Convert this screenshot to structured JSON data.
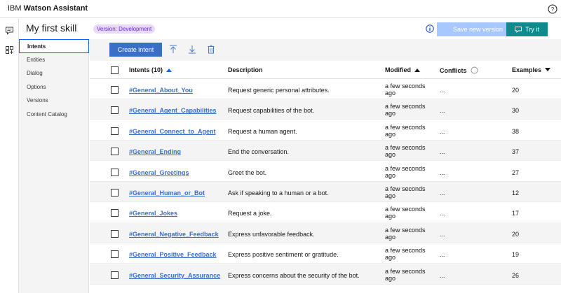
{
  "header": {
    "brand_prefix": "IBM",
    "brand_name": "Watson Assistant"
  },
  "skill": {
    "title": "My first skill",
    "version_badge": "Version: Development",
    "save_label": "Save new version",
    "try_label": "Try it"
  },
  "subnav": {
    "items": [
      {
        "label": "Intents",
        "active": true
      },
      {
        "label": "Entities"
      },
      {
        "label": "Dialog"
      },
      {
        "label": "Options"
      },
      {
        "label": "Versions"
      },
      {
        "label": "Content Catalog"
      }
    ]
  },
  "toolbar": {
    "create_label": "Create intent"
  },
  "table": {
    "columns": {
      "intents": "Intents (10)",
      "description": "Description",
      "modified": "Modified",
      "conflicts": "Conflicts",
      "examples": "Examples"
    },
    "rows": [
      {
        "intent": "#General_About_You",
        "description": "Request generic personal attributes.",
        "modified_1": "a few seconds",
        "modified_2": "ago",
        "conflicts": "...",
        "examples": "20"
      },
      {
        "intent": "#General_Agent_Capabilities",
        "description": "Request capabilities of the bot.",
        "modified_1": "a few seconds",
        "modified_2": "ago",
        "conflicts": "...",
        "examples": "30"
      },
      {
        "intent": "#General_Connect_to_Agent",
        "description": "Request a human agent.",
        "modified_1": "a few seconds",
        "modified_2": "ago",
        "conflicts": "...",
        "examples": "38"
      },
      {
        "intent": "#General_Ending",
        "description": "End the conversation.",
        "modified_1": "a few seconds",
        "modified_2": "ago",
        "conflicts": "...",
        "examples": "37"
      },
      {
        "intent": "#General_Greetings",
        "description": "Greet the bot.",
        "modified_1": "a few seconds",
        "modified_2": "ago",
        "conflicts": "...",
        "examples": "27"
      },
      {
        "intent": "#General_Human_or_Bot",
        "description": "Ask if speaking to a human or a bot.",
        "modified_1": "a few seconds",
        "modified_2": "ago",
        "conflicts": "...",
        "examples": "12"
      },
      {
        "intent": "#General_Jokes",
        "description": "Request a joke.",
        "modified_1": "a few seconds",
        "modified_2": "ago",
        "conflicts": "...",
        "examples": "17"
      },
      {
        "intent": "#General_Negative_Feedback",
        "description": "Express unfavorable feedback.",
        "modified_1": "a few seconds",
        "modified_2": "ago",
        "conflicts": "...",
        "examples": "20"
      },
      {
        "intent": "#General_Positive_Feedback",
        "description": "Express positive sentiment or gratitude.",
        "modified_1": "a few seconds",
        "modified_2": "ago",
        "conflicts": "...",
        "examples": "19"
      },
      {
        "intent": "#General_Security_Assurance",
        "description": "Express concerns about the security of the bot.",
        "modified_1": "a few seconds",
        "modified_2": "ago",
        "conflicts": "...",
        "examples": "26"
      }
    ]
  },
  "colors": {
    "primary": "#3a6fc9",
    "try_button": "#0f8b8d",
    "save_disabled": "#a6c8ff",
    "badge_bg": "#e8daff",
    "badge_text": "#6929c4"
  }
}
